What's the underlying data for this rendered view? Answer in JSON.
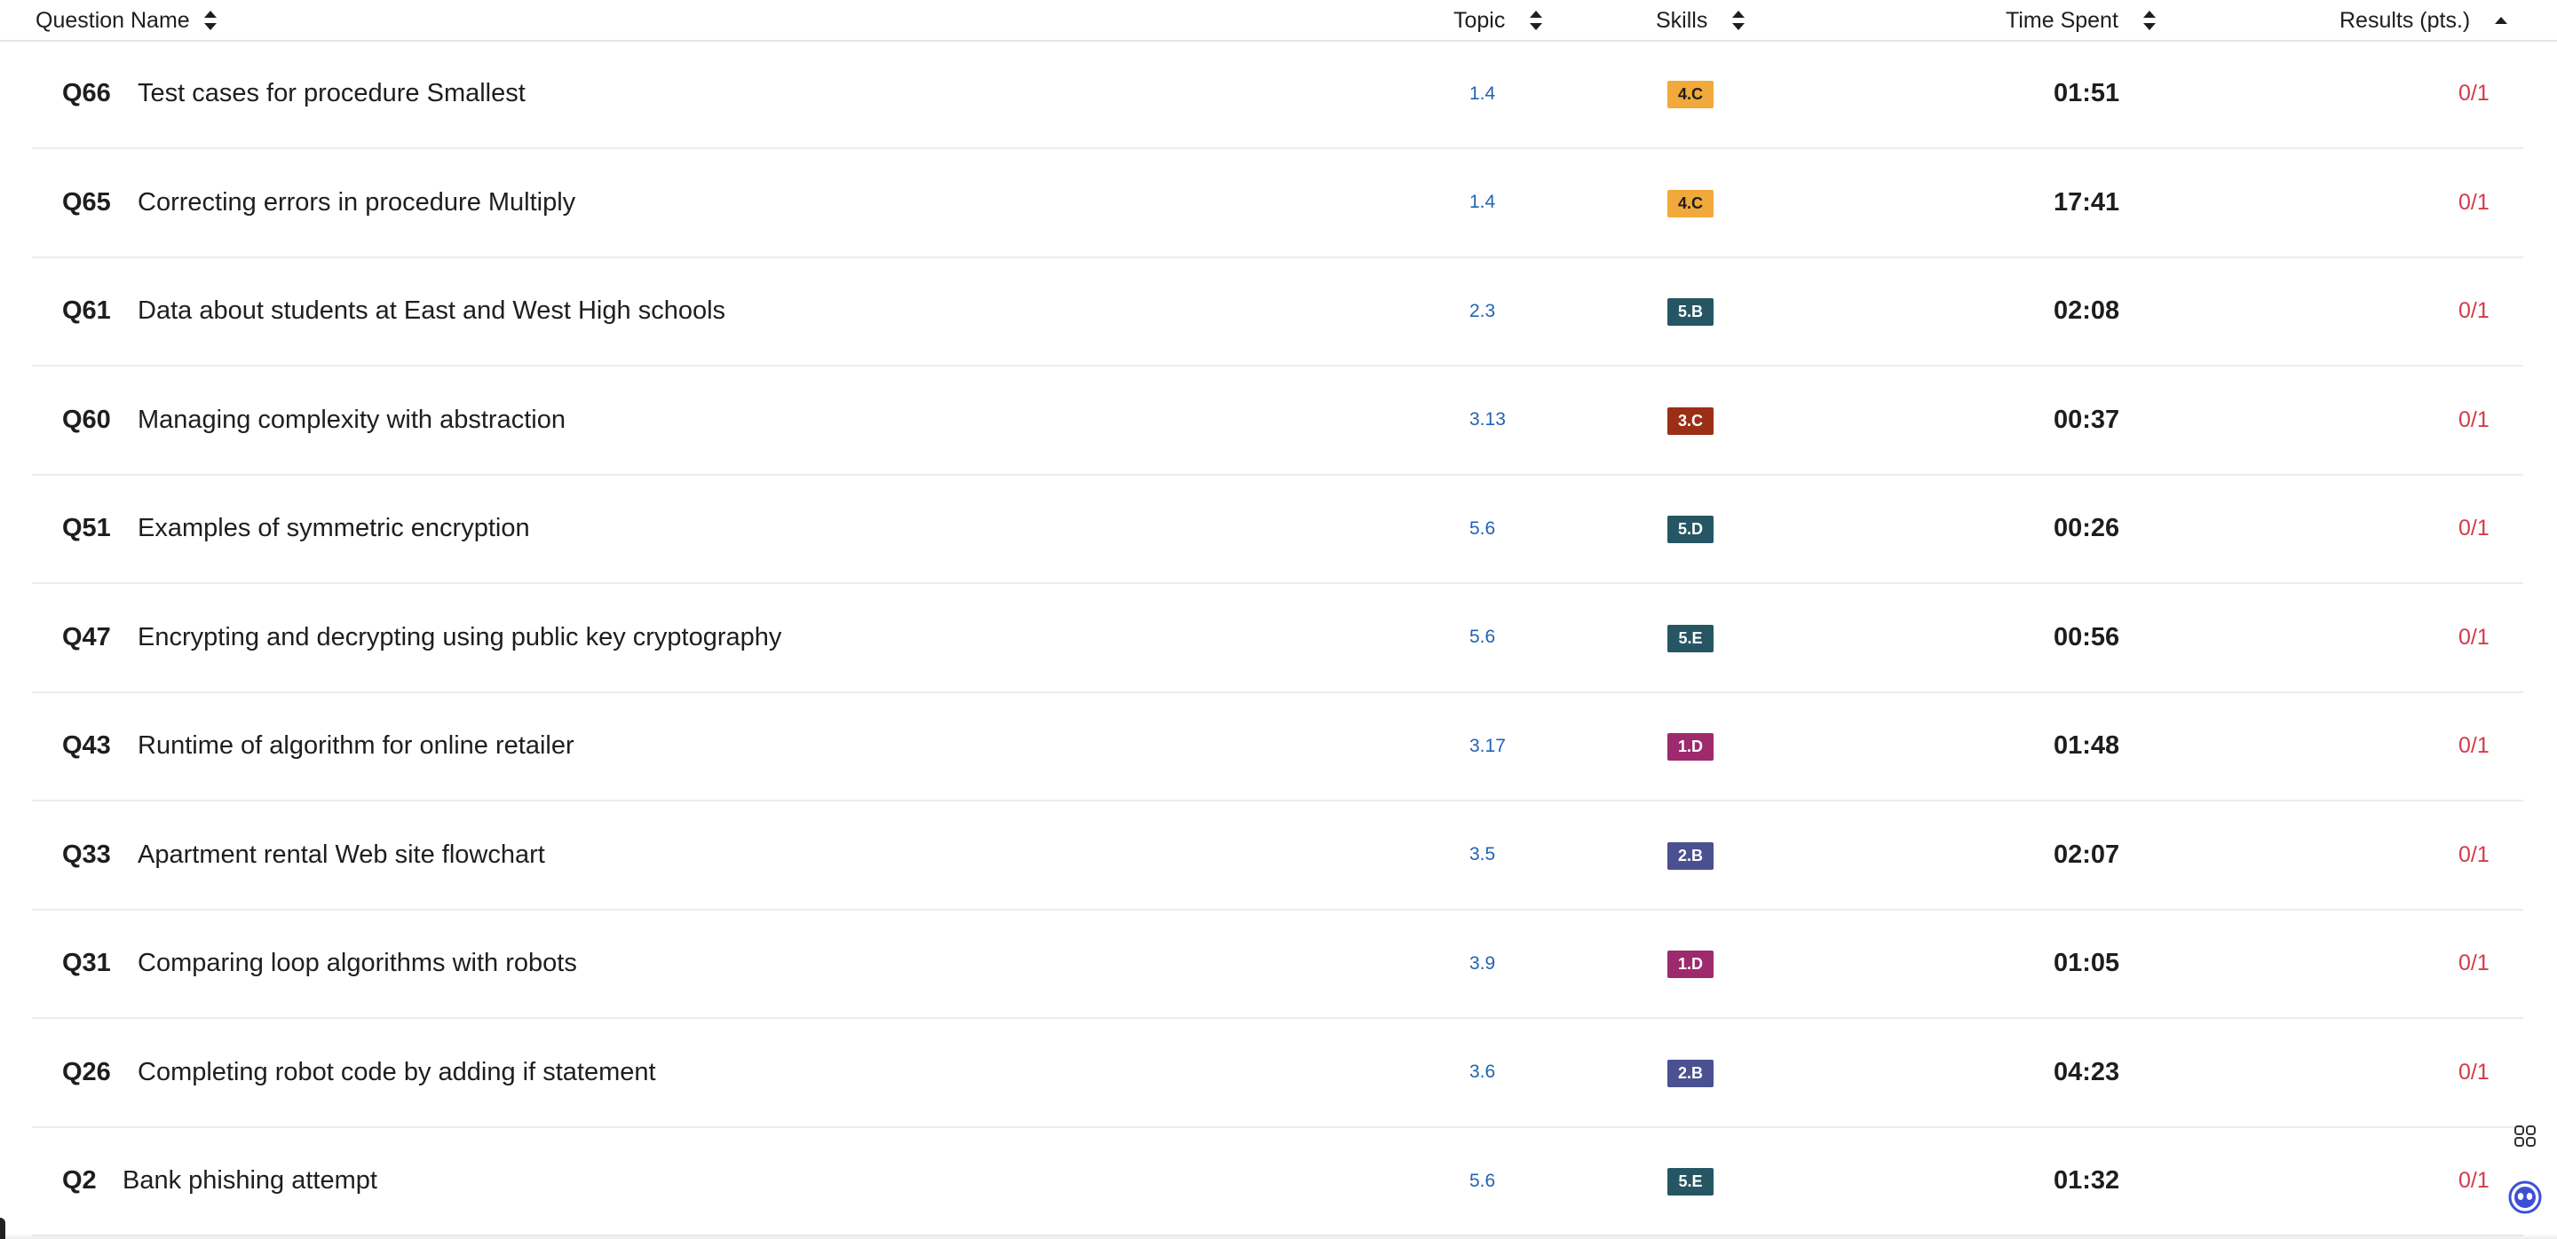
{
  "columns": {
    "question_name": "Question Name",
    "topic": "Topic",
    "skills": "Skills",
    "time_spent": "Time Spent",
    "results": "Results (pts.)"
  },
  "sorted_column": "results",
  "sort_direction": "ascending",
  "colors": {
    "topic_link": "#1f63b5",
    "result_text": "#d43a4a",
    "skill_4": "#f2a93b",
    "skill_5": "#265664",
    "skill_3": "#9b2f16",
    "skill_1": "#9e2a6e",
    "skill_2": "#4a5090"
  },
  "rows": [
    {
      "qnum": "Q66",
      "name": "Test cases for procedure Smallest",
      "topic": "1.4",
      "skill": "4.C",
      "skill_color": "#f2a93b",
      "skill_text_color": "#1e1e1e",
      "time": "01:51",
      "result": "0/1"
    },
    {
      "qnum": "Q65",
      "name": "Correcting errors in procedure Multiply",
      "topic": "1.4",
      "skill": "4.C",
      "skill_color": "#f2a93b",
      "skill_text_color": "#1e1e1e",
      "time": "17:41",
      "result": "0/1"
    },
    {
      "qnum": "Q61",
      "name": "Data about students at East and West High schools",
      "topic": "2.3",
      "skill": "5.B",
      "skill_color": "#265664",
      "skill_text_color": "#ffffff",
      "time": "02:08",
      "result": "0/1"
    },
    {
      "qnum": "Q60",
      "name": "Managing complexity with abstraction",
      "topic": "3.13",
      "skill": "3.C",
      "skill_color": "#9b2f16",
      "skill_text_color": "#ffffff",
      "time": "00:37",
      "result": "0/1"
    },
    {
      "qnum": "Q51",
      "name": "Examples of symmetric encryption",
      "topic": "5.6",
      "skill": "5.D",
      "skill_color": "#265664",
      "skill_text_color": "#ffffff",
      "time": "00:26",
      "result": "0/1"
    },
    {
      "qnum": "Q47",
      "name": "Encrypting and decrypting using public key cryptography",
      "topic": "5.6",
      "skill": "5.E",
      "skill_color": "#265664",
      "skill_text_color": "#ffffff",
      "time": "00:56",
      "result": "0/1"
    },
    {
      "qnum": "Q43",
      "name": "Runtime of algorithm for online retailer",
      "topic": "3.17",
      "skill": "1.D",
      "skill_color": "#9e2a6e",
      "skill_text_color": "#ffffff",
      "time": "01:48",
      "result": "0/1"
    },
    {
      "qnum": "Q33",
      "name": "Apartment rental Web site flowchart",
      "topic": "3.5",
      "skill": "2.B",
      "skill_color": "#4a5090",
      "skill_text_color": "#ffffff",
      "time": "02:07",
      "result": "0/1"
    },
    {
      "qnum": "Q31",
      "name": "Comparing loop algorithms with robots",
      "topic": "3.9",
      "skill": "1.D",
      "skill_color": "#9e2a6e",
      "skill_text_color": "#ffffff",
      "time": "01:05",
      "result": "0/1"
    },
    {
      "qnum": "Q26",
      "name": "Completing robot code by adding if statement",
      "topic": "3.6",
      "skill": "2.B",
      "skill_color": "#4a5090",
      "skill_text_color": "#ffffff",
      "time": "04:23",
      "result": "0/1"
    },
    {
      "qnum": "Q2",
      "name": "Bank phishing attempt",
      "topic": "5.6",
      "skill": "5.E",
      "skill_color": "#265664",
      "skill_text_color": "#ffffff",
      "time": "01:32",
      "result": "0/1"
    }
  ],
  "floating_buttons": {
    "grid_icon": "grid-icon",
    "assistant_icon": "assistant-icon"
  }
}
